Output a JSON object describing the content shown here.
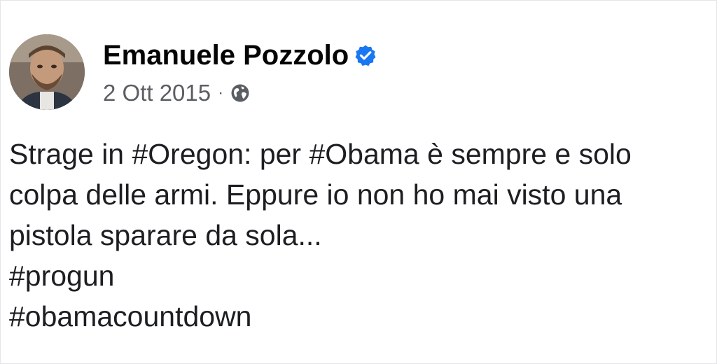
{
  "post": {
    "author_name": "Emanuele Pozzolo",
    "date": "2 Ott 2015",
    "separator": "·",
    "lines": [
      "Strage in #Oregon: per #Obama è sempre e solo",
      "colpa delle armi. Eppure io non ho mai visto una",
      "pistola sparare da sola...",
      "#progun",
      "#obamacountdown"
    ]
  },
  "icons": {
    "verified": "verified-badge-icon",
    "audience": "globe-icon"
  },
  "colors": {
    "verified_blue": "#1877f2",
    "name_text": "#050505",
    "meta_text": "#5b5e63",
    "body_text": "#1c1e21"
  }
}
